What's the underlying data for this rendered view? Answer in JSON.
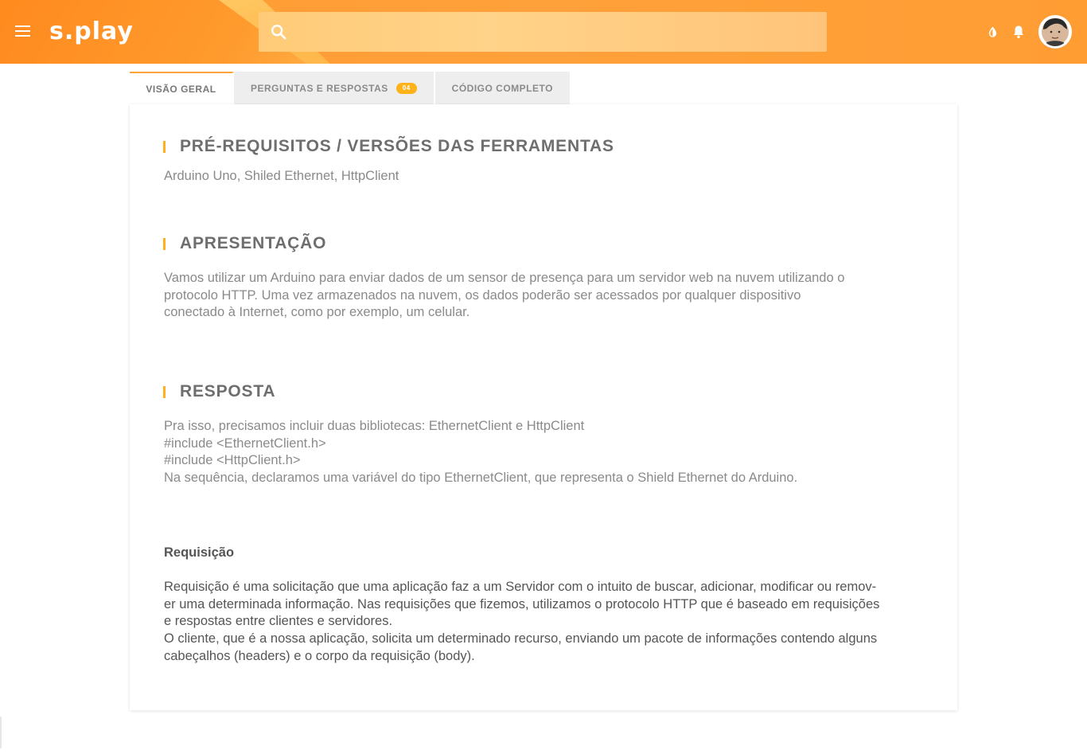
{
  "header": {
    "logo_text": "s.play",
    "search_placeholder": "",
    "accent_color": "#ff9a30"
  },
  "tabs": [
    {
      "label": "VISÃO GERAL",
      "active": true
    },
    {
      "label": "PERGUNTAS E RESPOSTAS",
      "badge": "04"
    },
    {
      "label": "CÓDIGO COMPLETO"
    }
  ],
  "content": {
    "prereq_title": "PRÉ-REQUISITOS / VERSÕES DAS FERRAMENTAS",
    "prereq_text": "Arduino Uno, Shiled Ethernet, HttpClient",
    "apresentacao_title": "APRESENTAÇÃO",
    "apresentacao_lines": [
      "Vamos utilizar um Arduino para enviar dados de um sensor de presença para um servidor web na nuvem utilizando o",
      "protocolo HTTP.  Uma vez armazenados na nuvem, os dados poderão ser acessados por qualquer dispositivo",
      "conectado à Internet, como por exemplo, um celular."
    ],
    "resposta_title": "RESPOSTA",
    "resposta_lines": [
      "Pra isso, precisamos incluir duas bibliotecas: EthernetClient e HttpClient",
      "#include <EthernetClient.h>",
      "#include <HttpClient.h>",
      "Na sequência, declaramos uma variável do tipo EthernetClient, que representa o Shield Ethernet do Arduino."
    ],
    "requisicao_title": "Requisição",
    "requisicao_lines": [
      "Requisição é uma solicitação que uma aplicação faz a um Servidor com o intuito de buscar, adicionar, modificar ou remov-",
      "er uma determinada informação. Nas requisições que fizemos, utilizamos o protocolo HTTP que é baseado em requisições",
      "e respostas entre clientes e servidores.",
      "O cliente, que é a nossa aplicação, solicita um determinado recurso, enviando um pacote de informações contendo alguns",
      "cabeçalhos (headers) e o corpo da requisição (body)."
    ]
  }
}
